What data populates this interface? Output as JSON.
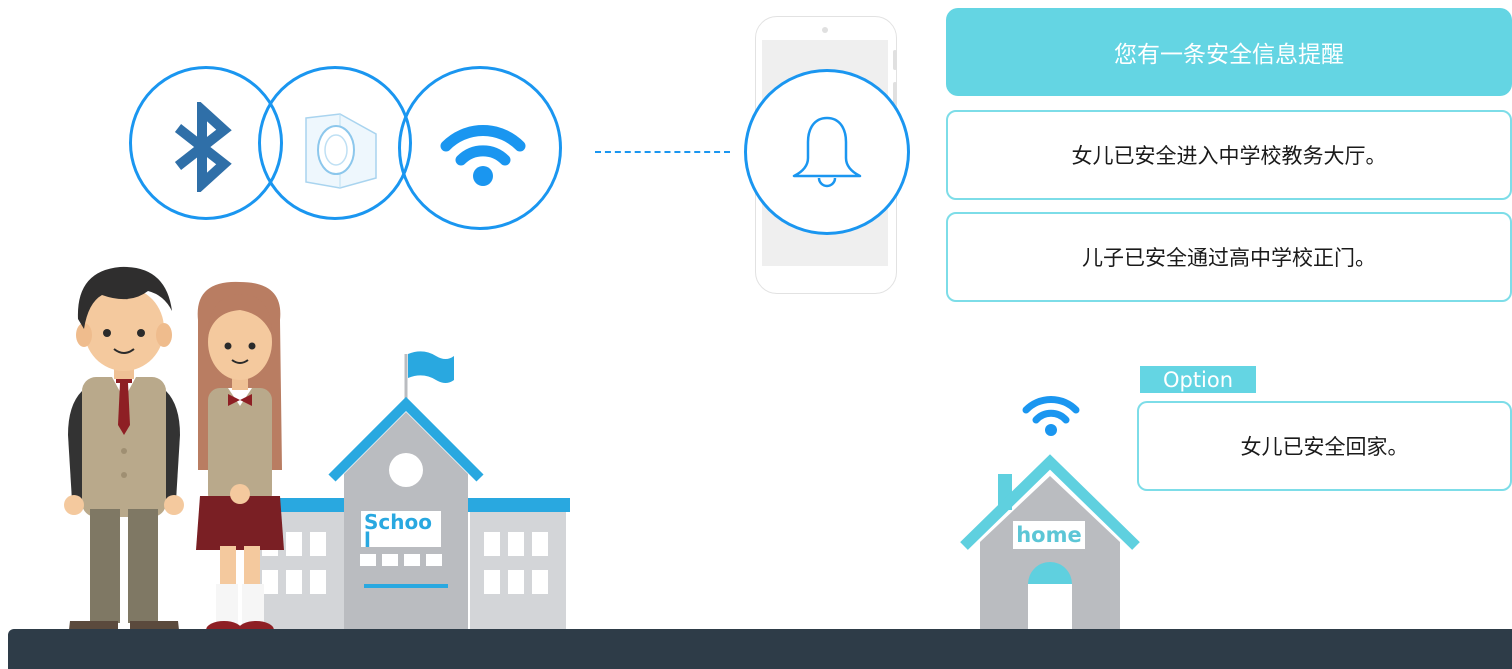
{
  "reminder": {
    "header": "您有一条安全信息提醒",
    "messages": [
      "女儿已安全进入中学校教务大厅。",
      "儿子已安全通过高中学校正门。"
    ]
  },
  "option": {
    "tag": "Option",
    "message": "女儿已安全回家。"
  },
  "school": {
    "sign": "Schoo\nl"
  },
  "home": {
    "sign": "home"
  },
  "icons": {
    "bluetooth": "bluetooth-icon",
    "beacon": "beacon-device-icon",
    "wifi": "wifi-icon",
    "bell": "bell-icon"
  },
  "colors": {
    "accent_blue": "#1a96f0",
    "teal": "#64d5e3",
    "bluetooth_blue": "#2f6fa8",
    "ground": "#2e3c48",
    "building_gray": "#b9bcc0"
  }
}
